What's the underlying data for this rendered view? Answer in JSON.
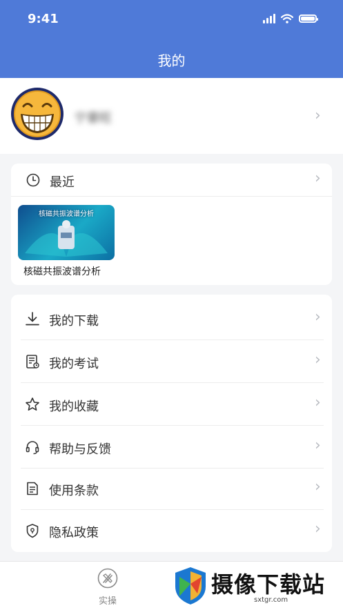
{
  "status_bar": {
    "time": "9:41"
  },
  "header": {
    "title": "我的"
  },
  "profile": {
    "username": "宁豪旺"
  },
  "recent": {
    "label": "最近",
    "items": [
      {
        "caption": "核磁共振波谱分析",
        "thumb_title": "核磁共振波谱分析"
      }
    ]
  },
  "menu": {
    "items": [
      {
        "label": "我的下载",
        "icon": "download-icon"
      },
      {
        "label": "我的考试",
        "icon": "exam-icon"
      },
      {
        "label": "我的收藏",
        "icon": "star-icon"
      },
      {
        "label": "帮助与反馈",
        "icon": "headset-icon"
      },
      {
        "label": "使用条款",
        "icon": "document-icon"
      },
      {
        "label": "隐私政策",
        "icon": "shield-icon"
      }
    ]
  },
  "tabbar": {
    "items": [
      {
        "label": "实操",
        "icon": "practice-icon"
      }
    ]
  },
  "watermark": {
    "text": "摄像下载站",
    "url": "sxtgr.com"
  },
  "colors": {
    "header": "#4f7ad8",
    "background": "#f4f5f7"
  }
}
